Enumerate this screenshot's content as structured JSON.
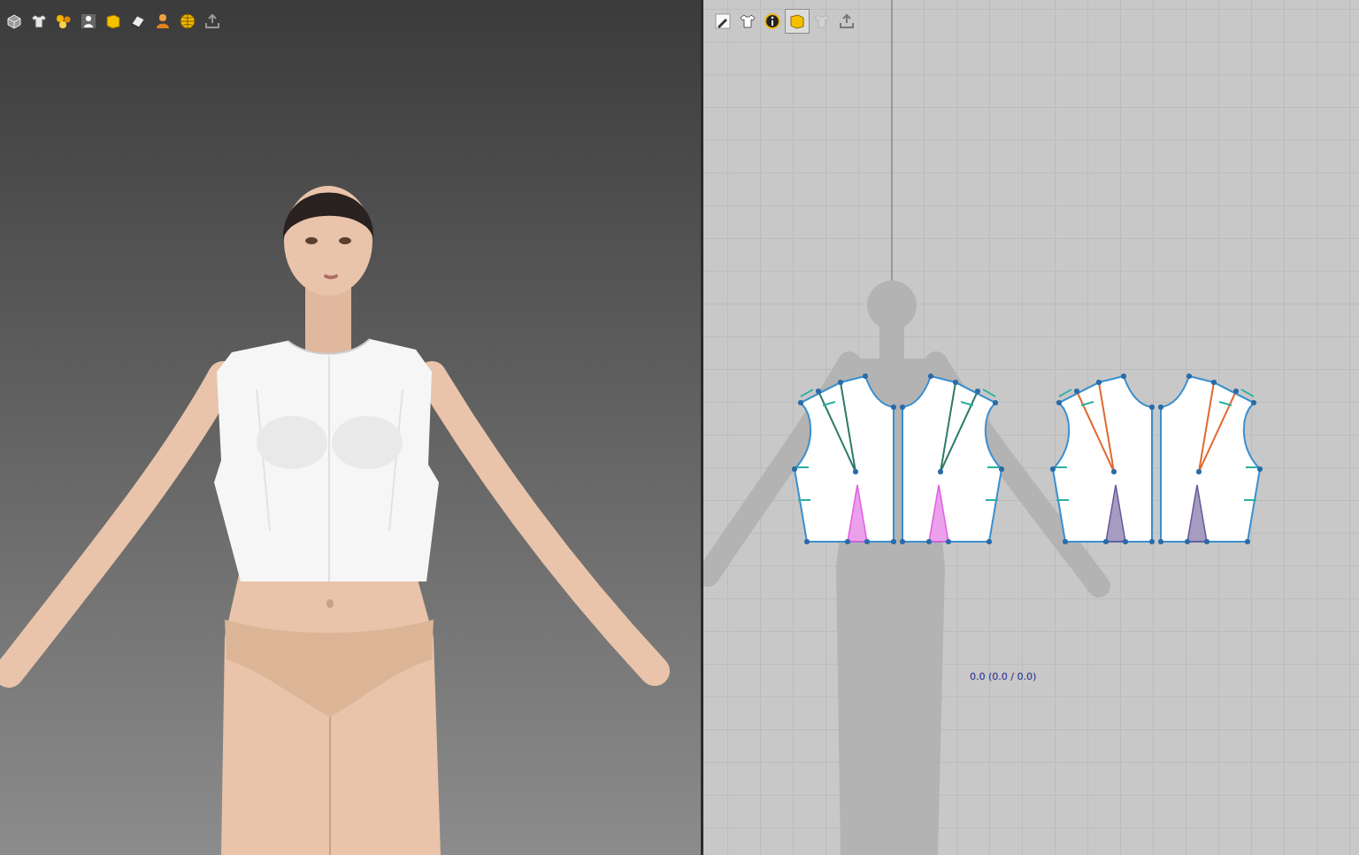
{
  "viewport_3d": {
    "toolbar": [
      {
        "selected": false
      },
      {
        "selected": false
      },
      {
        "selected": false
      },
      {
        "selected": false
      },
      {
        "selected": false
      },
      {
        "selected": false
      },
      {
        "selected": false
      },
      {
        "selected": false
      },
      {
        "selected": false
      }
    ]
  },
  "pattern_window": {
    "toolbar": [
      {
        "selected": false,
        "disabled": false
      },
      {
        "selected": false,
        "disabled": false
      },
      {
        "selected": false,
        "disabled": false
      },
      {
        "selected": true,
        "disabled": false
      },
      {
        "selected": false,
        "disabled": true
      },
      {
        "selected": false,
        "disabled": false
      }
    ],
    "readout": "0.0 (0.0 / 0.0)"
  }
}
